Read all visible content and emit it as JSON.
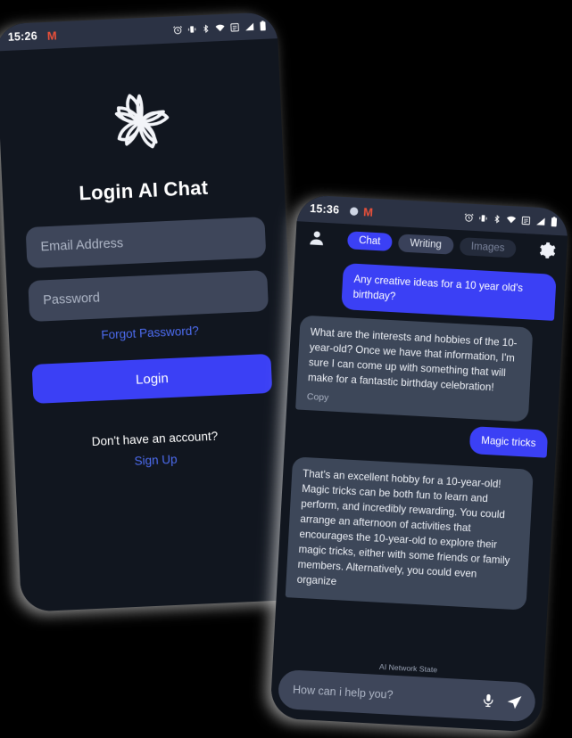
{
  "login_phone": {
    "status_bar": {
      "time": "15:26",
      "left_icons": [
        "gmail-icon"
      ],
      "right_icons": [
        "alarm-icon",
        "vibrate-icon",
        "bluetooth-icon",
        "wifi-icon",
        "volte-icon",
        "signal-icon",
        "battery-icon"
      ]
    },
    "logo_name": "flower-pinwheel-logo",
    "title": "Login AI Chat",
    "email_placeholder": "Email Address",
    "email_value": "",
    "password_placeholder": "Password",
    "password_value": "",
    "forgot_password": "Forgot Password?",
    "login_button": "Login",
    "no_account_text": "Don't have an account?",
    "sign_up": "Sign Up"
  },
  "chat_phone": {
    "status_bar": {
      "time": "15:36",
      "left_icons": [
        "app-badge-icon",
        "gmail-icon"
      ],
      "right_icons": [
        "alarm-icon",
        "vibrate-icon",
        "bluetooth-icon",
        "wifi-icon",
        "volte-icon",
        "signal-icon",
        "battery-icon"
      ]
    },
    "header": {
      "profile_icon": "person-icon",
      "settings_icon": "gear-icon",
      "tabs": [
        {
          "label": "Chat",
          "state": "active"
        },
        {
          "label": "Writing",
          "state": "normal"
        },
        {
          "label": "Images",
          "state": "muted"
        }
      ]
    },
    "messages": [
      {
        "role": "user",
        "text": "Any creative ideas for a 10 year old's birthday?"
      },
      {
        "role": "assistant",
        "text": "What are the interests and hobbies of the 10-year-old? Once we have that information, I'm sure I can come up with something that will make for a fantastic birthday celebration!",
        "action": "Copy"
      },
      {
        "role": "user",
        "text": "Magic tricks"
      },
      {
        "role": "assistant",
        "text": "That's an excellent hobby for a 10-year-old! Magic tricks can be both fun to learn and perform, and incredibly rewarding. You could arrange an afternoon of activities that encourages the 10-year-old to explore their magic tricks, either with some friends or family members. Alternatively, you could even organize"
      }
    ],
    "network_state": "AI Network State",
    "composer": {
      "placeholder": "How can i help you?",
      "value": "",
      "mic_icon": "microphone-icon",
      "send_icon": "send-icon"
    }
  },
  "colors": {
    "accent_blue": "#3b40f5",
    "link_blue": "#4d6cf0",
    "phone_bg": "#11161f",
    "field_bg": "#3e465a",
    "ai_bubble": "#3d4759",
    "status_bar_bg": "#2b3244"
  }
}
